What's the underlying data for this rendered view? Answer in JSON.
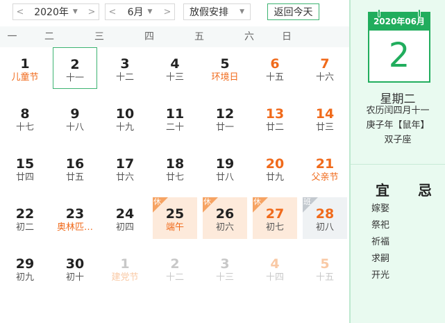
{
  "controls": {
    "year": "2020年",
    "month": "6月",
    "holiday": "放假安排",
    "prev": "<",
    "next": ">",
    "dropdown": "▼",
    "today_button": "返回今天"
  },
  "weekdays": [
    "一",
    "二",
    "三",
    "四",
    "五",
    "六",
    "日"
  ],
  "weeks": [
    [
      {
        "d": "1",
        "l": "儿童节",
        "fest": true
      },
      {
        "d": "2",
        "l": "十一",
        "today": true
      },
      {
        "d": "3",
        "l": "十二"
      },
      {
        "d": "4",
        "l": "十三"
      },
      {
        "d": "5",
        "l": "环境日",
        "fest": true
      },
      {
        "d": "6",
        "l": "十五",
        "weekend": true
      },
      {
        "d": "7",
        "l": "十六",
        "weekend": true
      }
    ],
    [
      {
        "d": "8",
        "l": "十七"
      },
      {
        "d": "9",
        "l": "十八"
      },
      {
        "d": "10",
        "l": "十九"
      },
      {
        "d": "11",
        "l": "二十"
      },
      {
        "d": "12",
        "l": "廿一"
      },
      {
        "d": "13",
        "l": "廿二",
        "weekend": true
      },
      {
        "d": "14",
        "l": "廿三",
        "weekend": true
      }
    ],
    [
      {
        "d": "15",
        "l": "廿四"
      },
      {
        "d": "16",
        "l": "廿五"
      },
      {
        "d": "17",
        "l": "廿六"
      },
      {
        "d": "18",
        "l": "廿七"
      },
      {
        "d": "19",
        "l": "廿八"
      },
      {
        "d": "20",
        "l": "廿九",
        "weekend": true
      },
      {
        "d": "21",
        "l": "父亲节",
        "weekend": true,
        "fest": true
      }
    ],
    [
      {
        "d": "22",
        "l": "初二"
      },
      {
        "d": "23",
        "l": "奥林匹…",
        "fest": true
      },
      {
        "d": "24",
        "l": "初四"
      },
      {
        "d": "25",
        "l": "端午",
        "fest": true,
        "tag": "休",
        "kind": "rest"
      },
      {
        "d": "26",
        "l": "初六",
        "tag": "休",
        "kind": "rest"
      },
      {
        "d": "27",
        "l": "初七",
        "tag": "休",
        "kind": "rest",
        "weekend": true
      },
      {
        "d": "28",
        "l": "初八",
        "tag": "班",
        "kind": "work",
        "weekend": true
      }
    ],
    [
      {
        "d": "29",
        "l": "初九"
      },
      {
        "d": "30",
        "l": "初十"
      },
      {
        "d": "1",
        "l": "建党节",
        "other": true,
        "fest": true
      },
      {
        "d": "2",
        "l": "十二",
        "other": true
      },
      {
        "d": "3",
        "l": "十三",
        "other": true
      },
      {
        "d": "4",
        "l": "十四",
        "other": true,
        "weekend": true
      },
      {
        "d": "5",
        "l": "十五",
        "other": true,
        "weekend": true
      }
    ]
  ],
  "panel": {
    "year_month": "2020年06月",
    "day": "2",
    "weekday": "星期二",
    "lunar": "农历闰四月十一",
    "ganzhi": "庚子年【鼠年】",
    "zodiac": "双子座",
    "yi_label": "宜",
    "ji_label": "忌",
    "yi": [
      "嫁娶",
      "祭祀",
      "祈福",
      "求嗣",
      "开光"
    ]
  },
  "colors": {
    "accent_green": "#21ad5d",
    "festival_orange": "#f06a1b",
    "rest_bg": "#fdeadb",
    "work_bg": "#eff2f4"
  }
}
